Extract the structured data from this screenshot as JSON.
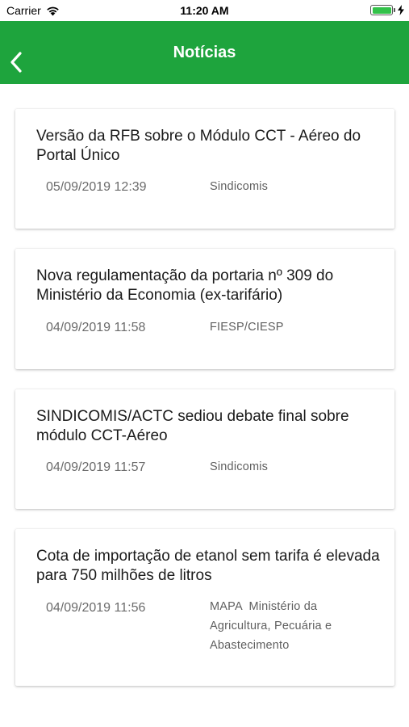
{
  "status_bar": {
    "carrier": "Carrier",
    "time": "11:20 AM"
  },
  "nav": {
    "title": "Notícias",
    "background_color": "#1ea43d"
  },
  "news": [
    {
      "title": "Versão da RFB sobre o Módulo CCT - Aéreo do Portal Único",
      "date": "05/09/2019 12:39",
      "source": "Sindicomis"
    },
    {
      "title": "Nova regulamentação da portaria nº 309 do Ministério da Economia (ex-tarifário)",
      "date": "04/09/2019 11:58",
      "source": "FIESP/CIESP"
    },
    {
      "title": "SINDICOMIS/ACTC sediou debate final sobre módulo CCT-Aéreo",
      "date": "04/09/2019 11:57",
      "source": "Sindicomis"
    },
    {
      "title": "Cota de importação de etanol sem tarifa é elevada para 750 milhões de litros",
      "date": "04/09/2019 11:56",
      "source": "MAPA  Ministério da Agricultura, Pecuária e Abastecimento"
    }
  ]
}
